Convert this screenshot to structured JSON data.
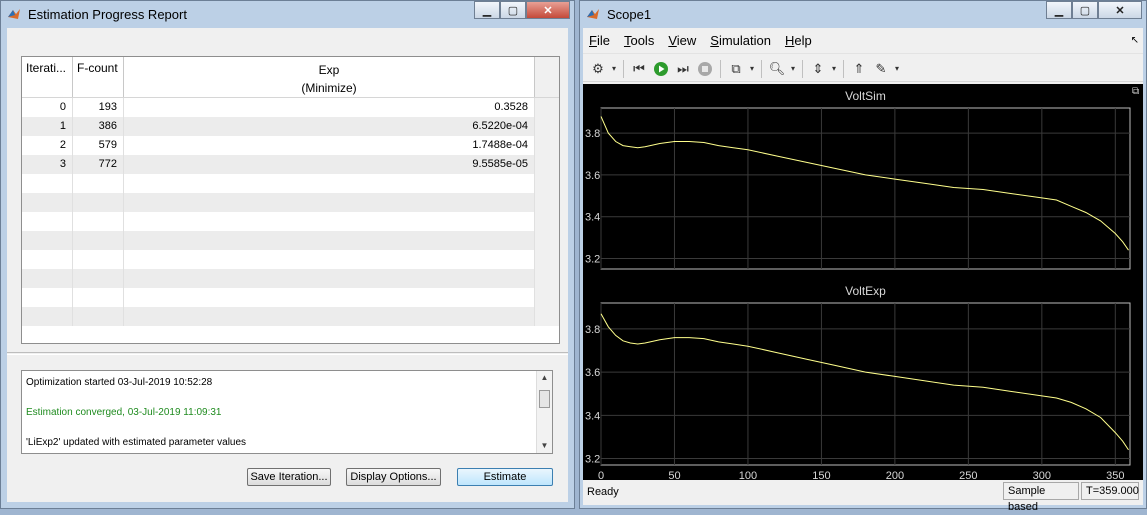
{
  "left_window": {
    "title": "Estimation Progress Report",
    "table": {
      "headers": [
        "Iterati...",
        "F-count",
        "Exp\n(Minimize)"
      ],
      "rows": [
        [
          "0",
          "193",
          "0.3528"
        ],
        [
          "1",
          "386",
          "6.5220e-04"
        ],
        [
          "2",
          "579",
          "1.7488e-04"
        ],
        [
          "3",
          "772",
          "9.5585e-05"
        ]
      ]
    },
    "log_lines": [
      {
        "text": "Optimization started 03-Jul-2019 10:52:28",
        "color": "#000000"
      },
      {
        "text": "",
        "color": "#000000"
      },
      {
        "text": "Estimation converged, 03-Jul-2019 11:09:31",
        "color": "#1f8b1f"
      },
      {
        "text": "",
        "color": "#000000"
      },
      {
        "text": "'LiExp2' updated with estimated parameter values",
        "color": "#000000"
      }
    ],
    "buttons": {
      "save_iteration": "Save Iteration...",
      "display_options": "Display Options...",
      "estimate": "Estimate"
    }
  },
  "right_window": {
    "title": "Scope1",
    "menus": [
      {
        "label": "File",
        "u": "F",
        "rest": "ile"
      },
      {
        "label": "Tools",
        "u": "T",
        "rest": "ools"
      },
      {
        "label": "View",
        "u": "V",
        "rest": "iew"
      },
      {
        "label": "Simulation",
        "u": "S",
        "rest": "imulation"
      },
      {
        "label": "Help",
        "u": "H",
        "rest": "elp"
      }
    ],
    "toolbar_icons": [
      "gear-icon",
      "step-back-icon",
      "run-icon",
      "step-forward-icon",
      "stop-icon",
      "highlight-icon",
      "zoom-icon",
      "scale-axes-icon",
      "trigger-icon",
      "cursor-icon"
    ],
    "status": {
      "left": "Ready",
      "mode": "Sample based",
      "time": "T=359.000"
    },
    "trace_color": "#ffff8c"
  },
  "chart_data": [
    {
      "type": "line",
      "title": "VoltSim",
      "xlabel": "",
      "ylabel": "",
      "xlim": [
        0,
        360
      ],
      "ylim": [
        3.15,
        3.92
      ],
      "yticks": [
        3.2,
        3.4,
        3.6,
        3.8
      ],
      "xticks": [
        0,
        50,
        100,
        150,
        200,
        250,
        300,
        350
      ],
      "grid": true,
      "series": [
        {
          "x": [
            0,
            5,
            10,
            15,
            20,
            25,
            30,
            40,
            50,
            60,
            70,
            80,
            90,
            100,
            120,
            140,
            160,
            180,
            200,
            220,
            240,
            260,
            280,
            300,
            310,
            320,
            330,
            340,
            350,
            355,
            359
          ],
          "y": [
            3.88,
            3.8,
            3.76,
            3.74,
            3.735,
            3.73,
            3.735,
            3.75,
            3.76,
            3.76,
            3.755,
            3.74,
            3.73,
            3.72,
            3.69,
            3.66,
            3.63,
            3.6,
            3.58,
            3.56,
            3.54,
            3.53,
            3.51,
            3.49,
            3.48,
            3.45,
            3.42,
            3.38,
            3.32,
            3.28,
            3.24
          ]
        }
      ]
    },
    {
      "type": "line",
      "title": "VoltExp",
      "xlabel": "",
      "ylabel": "",
      "xlim": [
        0,
        360
      ],
      "ylim": [
        3.17,
        3.92
      ],
      "yticks": [
        3.2,
        3.4,
        3.6,
        3.8
      ],
      "xticks": [
        0,
        50,
        100,
        150,
        200,
        250,
        300,
        350
      ],
      "grid": true,
      "series": [
        {
          "x": [
            0,
            5,
            10,
            15,
            20,
            25,
            30,
            40,
            50,
            60,
            70,
            80,
            90,
            100,
            120,
            140,
            160,
            180,
            200,
            220,
            240,
            260,
            280,
            300,
            310,
            320,
            330,
            340,
            350,
            355,
            359
          ],
          "y": [
            3.87,
            3.81,
            3.77,
            3.745,
            3.735,
            3.73,
            3.735,
            3.75,
            3.76,
            3.76,
            3.755,
            3.74,
            3.73,
            3.72,
            3.69,
            3.66,
            3.63,
            3.6,
            3.58,
            3.56,
            3.54,
            3.53,
            3.51,
            3.49,
            3.48,
            3.46,
            3.43,
            3.39,
            3.32,
            3.28,
            3.24
          ]
        }
      ]
    }
  ]
}
